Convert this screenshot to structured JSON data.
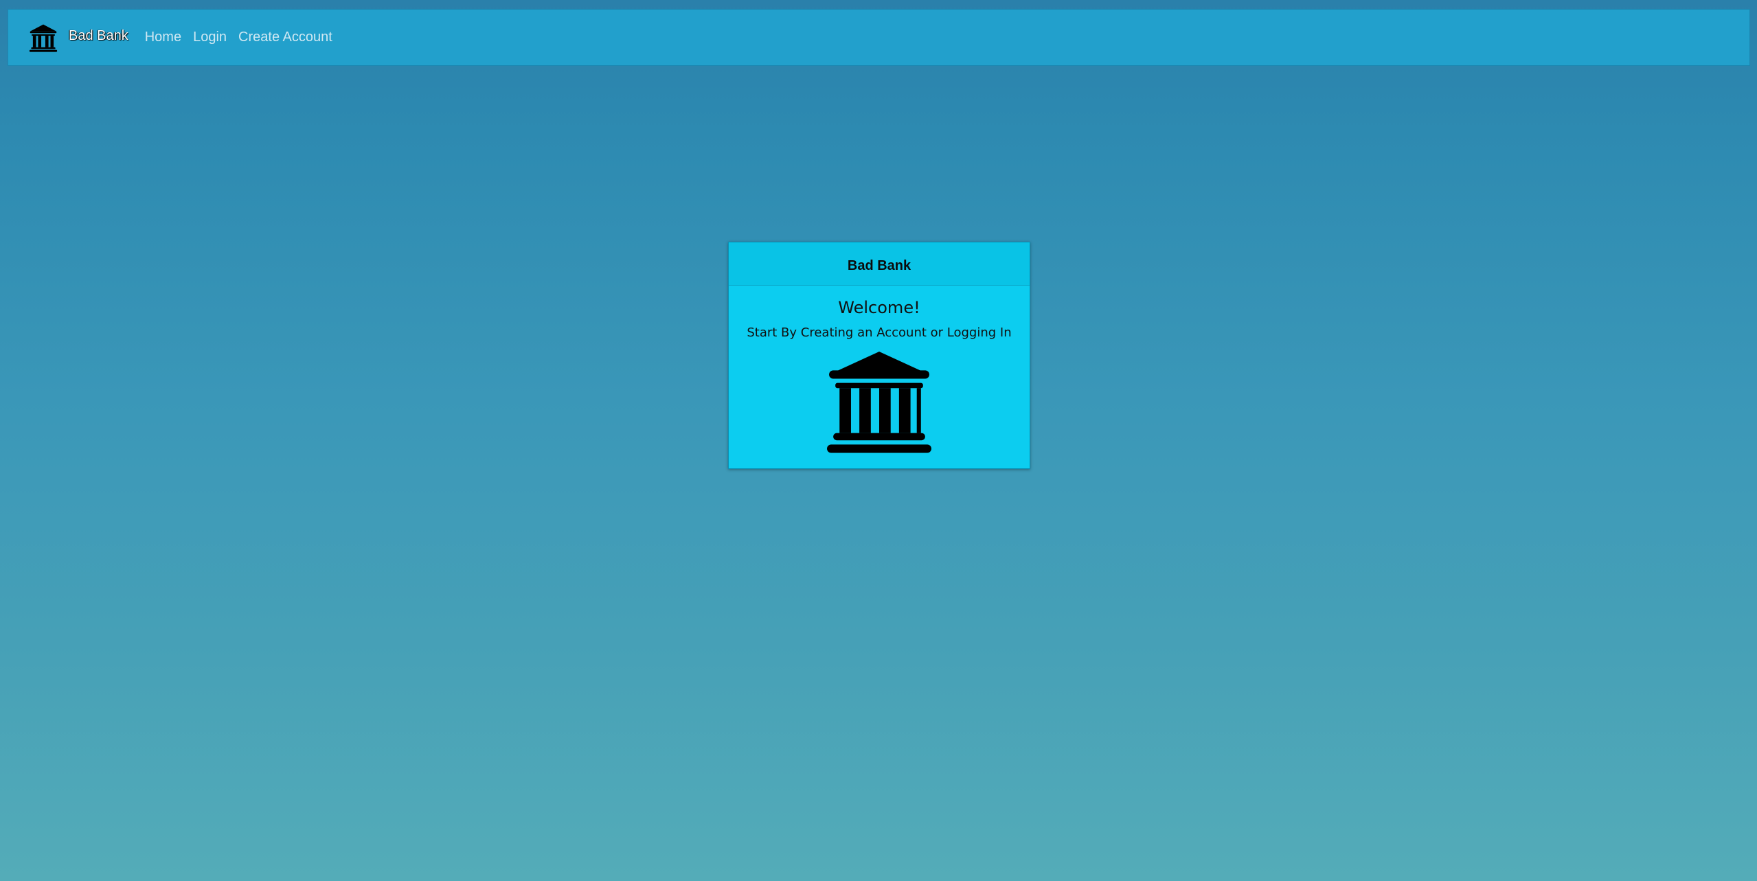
{
  "navbar": {
    "brand_icon": "bank-icon",
    "brand_label": "Bad Bank",
    "links": [
      {
        "label": "Home"
      },
      {
        "label": "Login"
      },
      {
        "label": "Create Account"
      }
    ]
  },
  "card": {
    "header": "Bad Bank",
    "title": "Welcome!",
    "text": "Start By Creating an Account or Logging In",
    "image_icon": "bank-icon"
  },
  "colors": {
    "navbar_bg": "#22a0cc",
    "card_bg": "#0ccdf0",
    "background_top": "#2a80ab",
    "background_bottom": "#54acb8"
  }
}
